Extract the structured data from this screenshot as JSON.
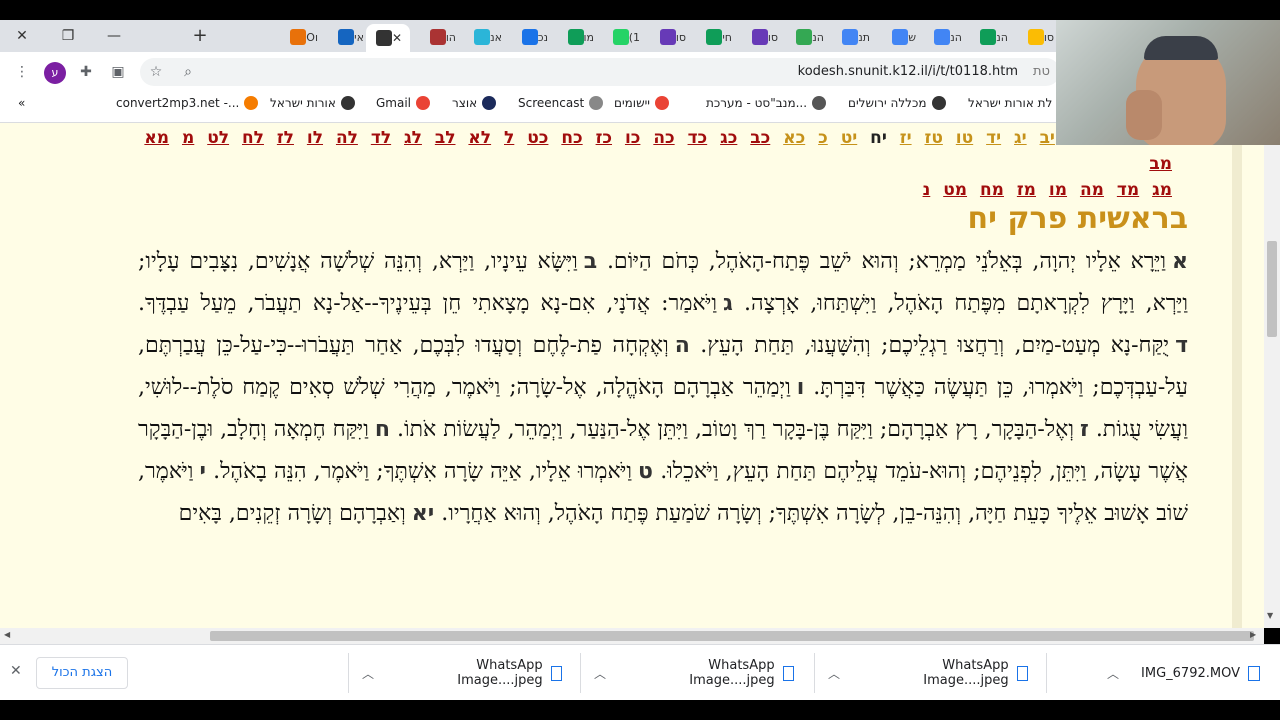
{
  "browser": {
    "tabs": [
      {
        "label": "סו",
        "color": "#fbbc04"
      },
      {
        "label": "הנ",
        "color": "#0f9d58"
      },
      {
        "label": "הנ",
        "color": "#4285f4"
      },
      {
        "label": "ש",
        "color": "#4285f4"
      },
      {
        "label": "תנ",
        "color": "#4285f4"
      },
      {
        "label": "הנ",
        "color": "#34a853"
      },
      {
        "label": "סו",
        "color": "#673ab7"
      },
      {
        "label": "חי",
        "color": "#0f9d58"
      },
      {
        "label": "סו",
        "color": "#673ab7"
      },
      {
        "label": "1)",
        "color": "#25d366"
      },
      {
        "label": "מו",
        "color": "#0f9d58"
      },
      {
        "label": "נכ",
        "color": "#1a73e8"
      },
      {
        "label": "אנ",
        "color": "#2bb5d8"
      },
      {
        "label": "הו",
        "color": "#a33"
      },
      {
        "label": "",
        "color": "#333",
        "active": true
      },
      {
        "label": "אי",
        "color": "#1565c0"
      },
      {
        "label": "Oı",
        "color": "#e8710a"
      }
    ],
    "url": "kodesh.snunit.k12.il/i/t/t0118.htm",
    "url_prefix": "טת",
    "avatar_letter": "ע",
    "bookmarks": [
      {
        "label": "לת אורות ישראל",
        "color": "#333"
      },
      {
        "label": "מכללה ירושלים",
        "color": "#333"
      },
      {
        "label": "מנב\"סט - מערכת...",
        "color": "#555"
      },
      {
        "label": "יישומים",
        "color": "#ea4335"
      },
      {
        "label": "Screencast",
        "color": "#888"
      },
      {
        "label": "אוצר",
        "color": "#1b2a5b"
      },
      {
        "label": "Gmail",
        "color": "#ea4335"
      },
      {
        "label": "אורות ישראל",
        "color": "#333"
      },
      {
        "label": "convert2mp3.net -...",
        "color": "#f57c00"
      }
    ],
    "bookmarks_overflow": "«"
  },
  "page": {
    "chapter_nav_row1": [
      "ז",
      "ח",
      "ט",
      "י",
      "יא",
      "יב",
      "יג",
      "יד",
      "טו",
      "טז",
      "יז",
      "יח",
      "יט",
      "כ",
      "כא",
      "כב",
      "כג",
      "כד",
      "כה",
      "כו",
      "כז",
      "כח",
      "כט",
      "ל",
      "לא",
      "לב",
      "לג",
      "לד",
      "לה",
      "לו",
      "לז",
      "לח",
      "לט",
      "מ",
      "מא",
      "מב"
    ],
    "chapter_nav_row2": [
      "מג",
      "מד",
      "מה",
      "מו",
      "מז",
      "מח",
      "מט",
      "נ"
    ],
    "current_chapter": "יח",
    "title": "בראשית פרק יח",
    "verses": [
      {
        "num": "א",
        "text": "וַיֵּרָא אֵלָיו יְהוָה, בְּאֵלֹנֵי מַמְרֵא; וְהוּא יֹשֵׁב פֶּתַח-הָאֹהֶל, כְּחֹם הַיּוֹם."
      },
      {
        "num": "ב",
        "text": "וַיִּשָּׂא עֵינָיו, וַיַּרְא, וְהִנֵּה שְׁלֹשָׁה אֲנָשִׁים, נִצָּבִים עָלָיו; וַיַּרְא, וַיָּרָץ לִקְרָאתָם מִפֶּתַח הָאֹהֶל, וַיִּשְׁתַּחוּ, אָרְצָה."
      },
      {
        "num": "ג",
        "text": "וַיֹּאמַר: אֲדֹנָי, אִם-נָא מָצָאתִי חֵן בְּעֵינֶיךָ--אַל-נָא תַעֲבֹר, מֵעַל עַבְדֶּךָ."
      },
      {
        "num": "ד",
        "text": "יֻקַּח-נָא מְעַט-מַיִם, וְרַחֲצוּ רַגְלֵיכֶם; וְהִשָּׁעֲנוּ, תַּחַת הָעֵץ."
      },
      {
        "num": "ה",
        "text": "וְאֶקְחָה פַת-לֶחֶם וְסַעֲדוּ לִבְּכֶם, אַחַר תַּעֲבֹרוּ--כִּי-עַל-כֵּן עֲבַרְתֶּם, עַל-עַבְדְּכֶם; וַיֹּאמְרוּ, כֵּן תַּעֲשֶׂה כַּאֲשֶׁר דִּבַּרְתָּ."
      },
      {
        "num": "ו",
        "text": "וַיְמַהֵר אַבְרָהָם הָאֹהֱלָה, אֶל-שָׂרָה; וַיֹּאמֶר, מַהֲרִי שְׁלֹשׁ סְאִים קֶמַח סֹלֶת--לוּשִׁי, וַעֲשִׂי עֻגוֹת."
      },
      {
        "num": "ז",
        "text": "וְאֶל-הַבָּקָר, רָץ אַבְרָהָם; וַיִּקַּח בֶּן-בָּקָר רַךְ וָטוֹב, וַיִּתֵּן אֶל-הַנַּעַר, וַיְמַהֵר, לַעֲשׂוֹת אֹתוֹ."
      },
      {
        "num": "ח",
        "text": "וַיִּקַּח חֶמְאָה וְחָלָב, וּבֶן-הַבָּקָר אֲשֶׁר עָשָׂה, וַיִּתֵּן, לִפְנֵיהֶם; וְהוּא-עֹמֵד עֲלֵיהֶם תַּחַת הָעֵץ, וַיֹּאכֵלוּ."
      },
      {
        "num": "ט",
        "text": "וַיֹּאמְרוּ אֵלָיו, אַיֵּה שָׂרָה אִשְׁתֶּךָ; וַיֹּאמֶר, הִנֵּה בָאֹהֶל."
      },
      {
        "num": "י",
        "text": "וַיֹּאמֶר, שׁוֹב אָשׁוּב אֵלֶיךָ כָּעֵת חַיָּה, וְהִנֵּה-בֵן, לְשָׂרָה אִשְׁתֶּךָ; וְשָׂרָה שֹׁמַעַת פֶּתַח הָאֹהֶל, וְהוּא אַחֲרָיו."
      },
      {
        "num": "יא",
        "text": "וְאַבְרָהָם וְשָׂרָה זְקֵנִים, בָּאִים"
      }
    ]
  },
  "downloads": {
    "items": [
      "IMG_6792.MOV",
      "WhatsApp Image....jpeg",
      "WhatsApp Image....jpeg",
      "WhatsApp Image....jpeg"
    ],
    "show_all": "הצגת הכול",
    "close": "✕"
  }
}
